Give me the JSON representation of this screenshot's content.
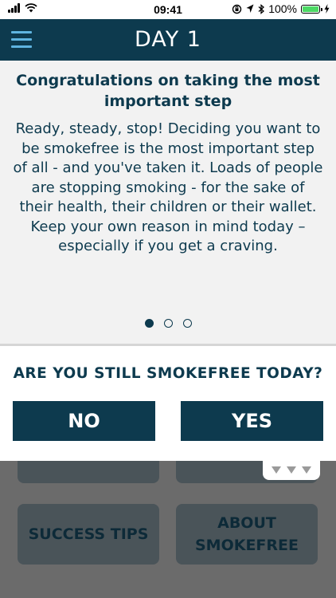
{
  "status_bar": {
    "time": "09:41",
    "battery": "100%"
  },
  "nav": {
    "title": "DAY 1",
    "menu_icon": "hamburger-icon"
  },
  "card": {
    "heading": "Congratulations on taking the most important step",
    "body": "Ready, steady, stop! Deciding you want to be smokefree is the most important step of all - and you've taken it. Loads of people are stopping smoking - for the sake of their health, their children or their wallet. Keep your own reason in mind today – especially if you get a craving.",
    "pages": 3,
    "active_page": 1
  },
  "question": {
    "text": "ARE YOU STILL SMOKEFREE TODAY?",
    "no_label": "NO",
    "yes_label": "YES"
  },
  "tiles": {
    "success_tips": "SUCCESS TIPS",
    "about": "ABOUT SMOKEFREE"
  },
  "colors": {
    "primary": "#0d3a4e",
    "accent": "#5fb4e0",
    "battery": "#4cd964"
  }
}
